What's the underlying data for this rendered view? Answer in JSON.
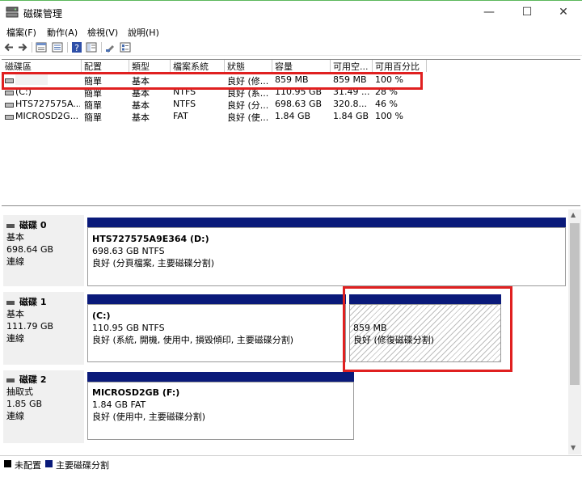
{
  "window": {
    "title": "磁碟管理"
  },
  "menu": [
    "檔案(F)",
    "動作(A)",
    "檢視(V)",
    "說明(H)"
  ],
  "columns": [
    "磁碟區",
    "配置",
    "類型",
    "檔案系統",
    "狀態",
    "容量",
    "可用空...",
    "可用百分比"
  ],
  "volumes": [
    {
      "name": "",
      "layout": "簡單",
      "type": "基本",
      "fs": "",
      "status": "良好 (修...",
      "capacity": "859 MB",
      "free": "859 MB",
      "pct": "100 %"
    },
    {
      "name": "(C:)",
      "layout": "簡單",
      "type": "基本",
      "fs": "NTFS",
      "status": "良好 (系...",
      "capacity": "110.95 GB",
      "free": "31.49 ...",
      "pct": "28 %"
    },
    {
      "name": "HTS727575A...",
      "layout": "簡單",
      "type": "基本",
      "fs": "NTFS",
      "status": "良好 (分...",
      "capacity": "698.63 GB",
      "free": "320.8...",
      "pct": "46 %"
    },
    {
      "name": "MICROSD2G...",
      "layout": "簡單",
      "type": "基本",
      "fs": "FAT",
      "status": "良好 (使...",
      "capacity": "1.84 GB",
      "free": "1.84 GB",
      "pct": "100 %"
    }
  ],
  "disks": [
    {
      "name": "磁碟 0",
      "kind": "基本",
      "size": "698.64 GB",
      "state": "連線",
      "partitions": [
        {
          "title": "HTS727575A9E364  (D:)",
          "detail": "698.63 GB NTFS",
          "status": "良好 (分頁檔案, 主要磁碟分割)"
        }
      ]
    },
    {
      "name": "磁碟 1",
      "kind": "基本",
      "size": "111.79 GB",
      "state": "連線",
      "partitions": [
        {
          "title": "(C:)",
          "detail": "110.95 GB NTFS",
          "status": "良好 (系統, 開機, 使用中, 損毀傾印, 主要磁碟分割)"
        },
        {
          "title": "",
          "detail": "859 MB",
          "status": "良好 (修復磁碟分割)"
        }
      ]
    },
    {
      "name": "磁碟 2",
      "kind": "抽取式",
      "size": "1.85 GB",
      "state": "連線",
      "partitions": [
        {
          "title": "MICROSD2GB  (F:)",
          "detail": "1.84 GB FAT",
          "status": "良好 (使用中, 主要磁碟分割)"
        }
      ]
    }
  ],
  "legend": [
    {
      "label": "未配置",
      "color": "#000000"
    },
    {
      "label": "主要磁碟分割",
      "color": "#0a1a7a"
    }
  ],
  "colors": {
    "highlight": "#e02020",
    "primary_partition": "#0a1a7a"
  }
}
